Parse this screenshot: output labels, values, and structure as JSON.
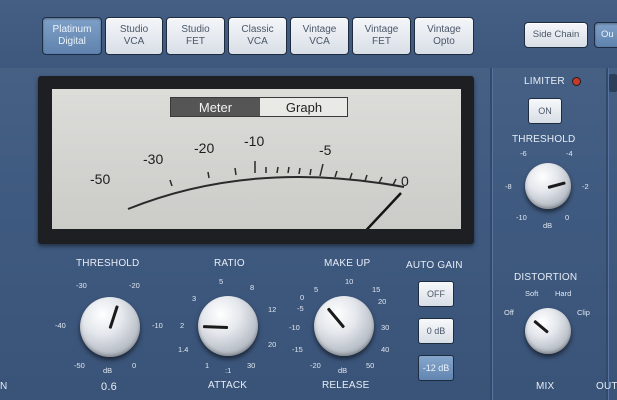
{
  "circuit_types": [
    {
      "line1": "Platinum",
      "line2": "Digital",
      "selected": true
    },
    {
      "line1": "Studio",
      "line2": "VCA",
      "selected": false
    },
    {
      "line1": "Studio",
      "line2": "FET",
      "selected": false
    },
    {
      "line1": "Classic",
      "line2": "VCA",
      "selected": false
    },
    {
      "line1": "Vintage",
      "line2": "VCA",
      "selected": false
    },
    {
      "line1": "Vintage",
      "line2": "FET",
      "selected": false
    },
    {
      "line1": "Vintage",
      "line2": "Opto",
      "selected": false
    }
  ],
  "side_chain_label": "Side Chain",
  "output_tab_partial": "Ou",
  "meter": {
    "tab_meter": "Meter",
    "tab_graph": "Graph",
    "active_tab": "Meter",
    "scale": [
      "-50",
      "-30",
      "-20",
      "-10",
      "-5",
      "0"
    ]
  },
  "threshold": {
    "label": "THRESHOLD",
    "ticks": [
      "-30",
      "-20",
      "-40",
      "-10",
      "-50",
      "0"
    ],
    "unit": "dB",
    "value": "0.6"
  },
  "ratio": {
    "label": "RATIO",
    "ticks": [
      "5",
      "8",
      "3",
      "12",
      "2",
      "20",
      "1.4",
      "30",
      "1",
      ":1"
    ]
  },
  "attack_label": "ATTACK",
  "makeup": {
    "label": "MAKE UP",
    "ticks": [
      "5",
      "10",
      "0",
      "15",
      "-5",
      "20",
      "-10",
      "30",
      "-15",
      "40",
      "-20",
      "50"
    ],
    "unit": "dB"
  },
  "release_label": "RELEASE",
  "auto_gain": {
    "label": "AUTO GAIN",
    "options": [
      "OFF",
      "0 dB",
      "-12 dB"
    ],
    "selected": "-12 dB"
  },
  "limiter": {
    "label": "LIMITER",
    "on_label": "ON",
    "threshold_label": "THRESHOLD",
    "ticks": [
      "-6",
      "-4",
      "-8",
      "-2",
      "-10",
      "0"
    ],
    "unit": "dB"
  },
  "distortion": {
    "label": "DISTORTION",
    "ticks": [
      "Soft",
      "Hard",
      "Off",
      "Clip"
    ]
  },
  "mix_label": "MIX",
  "output_label_partial": "OUT",
  "input_label_partial": "IN",
  "colors": {
    "panel": "#3f5a80",
    "active_button": "#6a8db7",
    "meter_face": "#d3d4d1",
    "limiter_led": "#c43b2e"
  }
}
